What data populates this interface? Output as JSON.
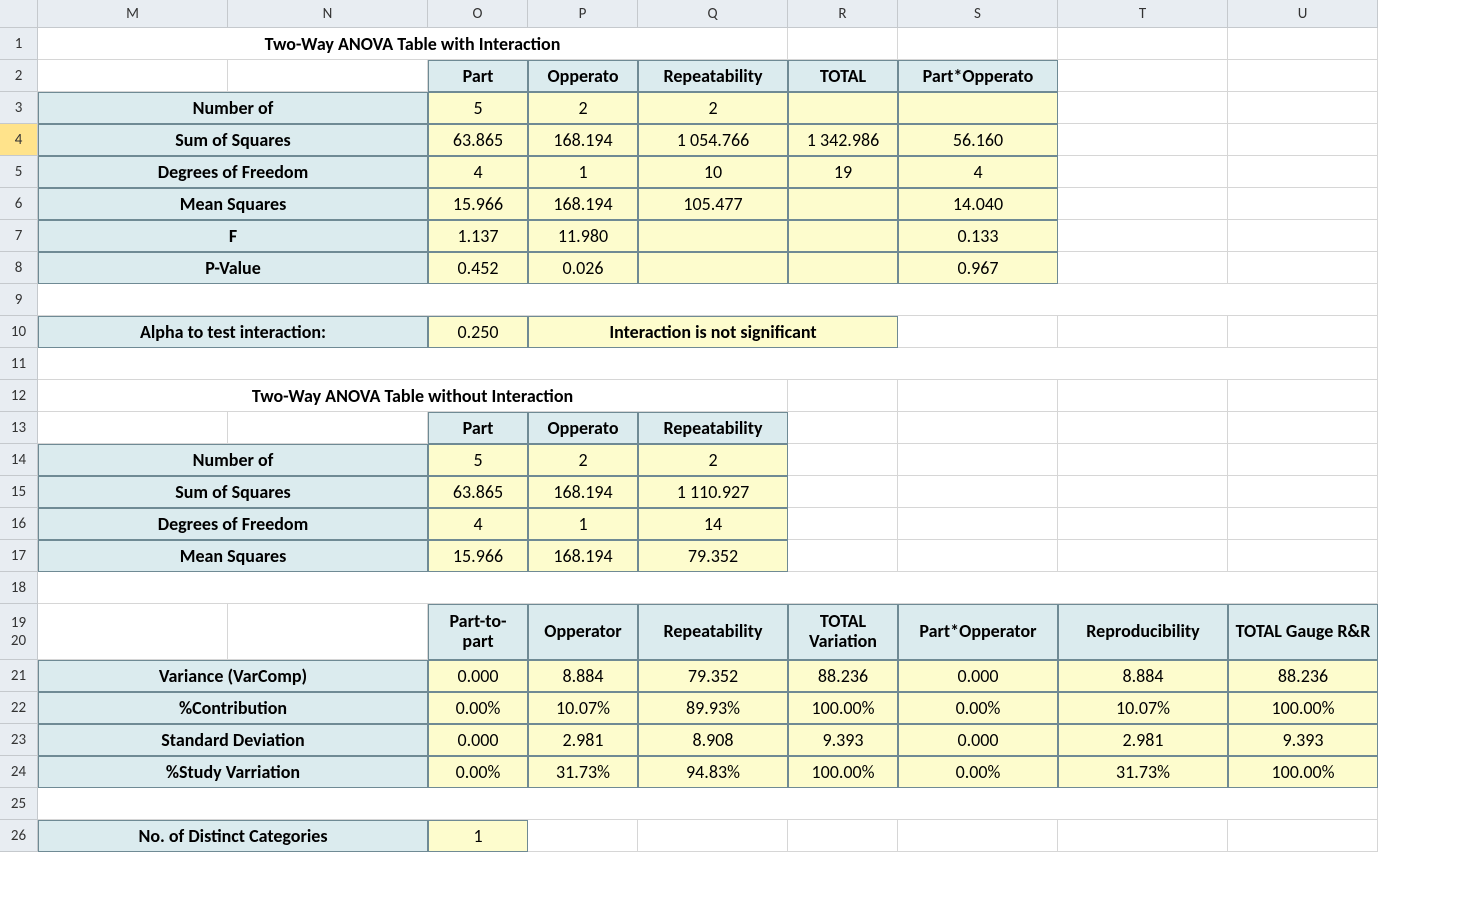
{
  "columns": [
    "M",
    "N",
    "O",
    "P",
    "Q",
    "R",
    "S",
    "T",
    "U"
  ],
  "row_numbers": [
    1,
    2,
    3,
    4,
    5,
    6,
    7,
    8,
    9,
    10,
    11,
    12,
    13,
    14,
    15,
    16,
    17,
    18,
    19,
    20,
    21,
    22,
    23,
    24,
    25,
    26
  ],
  "selected_row": 4,
  "section1": {
    "title": "Two-Way ANOVA Table with Interaction",
    "cols": {
      "O": "Part",
      "P": "Opperato",
      "Q": "Repeatability",
      "R": "TOTAL",
      "S": "Part*Opperato"
    },
    "rows": [
      {
        "label": "Number of",
        "O": "5",
        "P": "2",
        "Q": "2"
      },
      {
        "label": "Sum of Squares",
        "O": "63.865",
        "P": "168.194",
        "Q": "1 054.766",
        "R": "1 342.986",
        "S": "56.160"
      },
      {
        "label": "Degrees of Freedom",
        "O": "4",
        "P": "1",
        "Q": "10",
        "R": "19",
        "S": "4"
      },
      {
        "label": "Mean Squares",
        "O": "15.966",
        "P": "168.194",
        "Q": "105.477",
        "S": "14.040"
      },
      {
        "label": "F",
        "O": "1.137",
        "P": "11.980",
        "S": "0.133"
      },
      {
        "label": "P-Value",
        "O": "0.452",
        "P": "0.026",
        "S": "0.967"
      }
    ]
  },
  "alpha": {
    "label": "Alpha to test interaction:",
    "value": "0.250",
    "message": "Interaction is not significant"
  },
  "section2": {
    "title": "Two-Way ANOVA Table without Interaction",
    "cols": {
      "O": "Part",
      "P": "Opperato",
      "Q": "Repeatability"
    },
    "rows": [
      {
        "label": "Number of",
        "O": "5",
        "P": "2",
        "Q": "2"
      },
      {
        "label": "Sum of Squares",
        "O": "63.865",
        "P": "168.194",
        "Q": "1 110.927"
      },
      {
        "label": "Degrees of Freedom",
        "O": "4",
        "P": "1",
        "Q": "14"
      },
      {
        "label": "Mean Squares",
        "O": "15.966",
        "P": "168.194",
        "Q": "79.352"
      }
    ]
  },
  "section3": {
    "cols": {
      "O": "Part-to-part",
      "P": "Opperator",
      "Q": "Repeatability",
      "R": "TOTAL Variation",
      "S": "Part*Opperator",
      "T": "Reproducibility",
      "U": "TOTAL Gauge R&R"
    },
    "rows": [
      {
        "label": "Variance (VarComp)",
        "O": "0.000",
        "P": "8.884",
        "Q": "79.352",
        "R": "88.236",
        "S": "0.000",
        "T": "8.884",
        "U": "88.236"
      },
      {
        "label": "%Contribution",
        "O": "0.00%",
        "P": "10.07%",
        "Q": "89.93%",
        "R": "100.00%",
        "S": "0.00%",
        "T": "10.07%",
        "U": "100.00%"
      },
      {
        "label": "Standard Deviation",
        "O": "0.000",
        "P": "2.981",
        "Q": "8.908",
        "R": "9.393",
        "S": "0.000",
        "T": "2.981",
        "U": "9.393"
      },
      {
        "label": "%Study Varriation",
        "O": "0.00%",
        "P": "31.73%",
        "Q": "94.83%",
        "R": "100.00%",
        "S": "0.00%",
        "T": "31.73%",
        "U": "100.00%"
      }
    ]
  },
  "distinct": {
    "label": "No. of Distinct Categories",
    "value": "1"
  }
}
